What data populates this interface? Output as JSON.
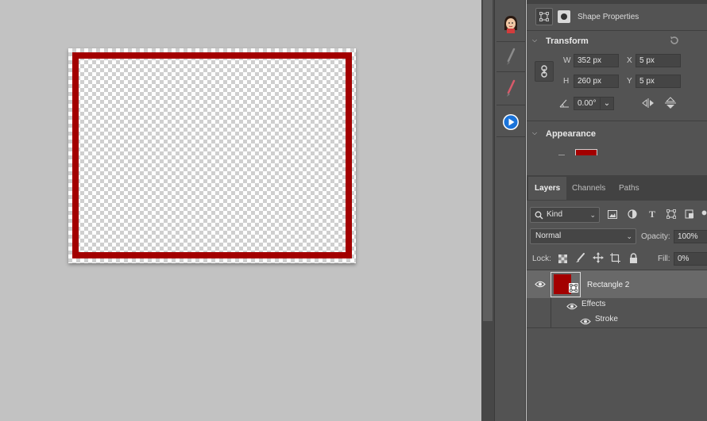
{
  "properties_panel": {
    "header_label": "Shape Properties",
    "transform": {
      "title": "Transform",
      "w_label": "W",
      "w_value": "352 px",
      "h_label": "H",
      "h_value": "260 px",
      "x_label": "X",
      "x_value": "5 px",
      "y_label": "Y",
      "y_value": "5 px",
      "angle_value": "0.00°"
    },
    "appearance": {
      "title": "Appearance",
      "fill_color": "#a30000"
    }
  },
  "layers_panel": {
    "tabs": [
      {
        "label": "Layers",
        "active": true
      },
      {
        "label": "Channels",
        "active": false
      },
      {
        "label": "Paths",
        "active": false
      }
    ],
    "filter_kind": "Kind",
    "blend_mode": "Normal",
    "opacity_label": "Opacity:",
    "opacity_value": "100%",
    "lock_label": "Lock:",
    "fill_label": "Fill:",
    "fill_value": "0%",
    "layers": [
      {
        "name": "Rectangle 2",
        "thumb_color": "#a30000"
      }
    ],
    "effects_label": "Effects",
    "stroke_label": "Stroke"
  },
  "canvas": {
    "stroke_color": "#a30000",
    "fill_opacity": "0%"
  },
  "colors": {
    "panel_bg": "#535353",
    "workspace_bg": "#c2c2c2",
    "selected_layer_bg": "#696969"
  }
}
